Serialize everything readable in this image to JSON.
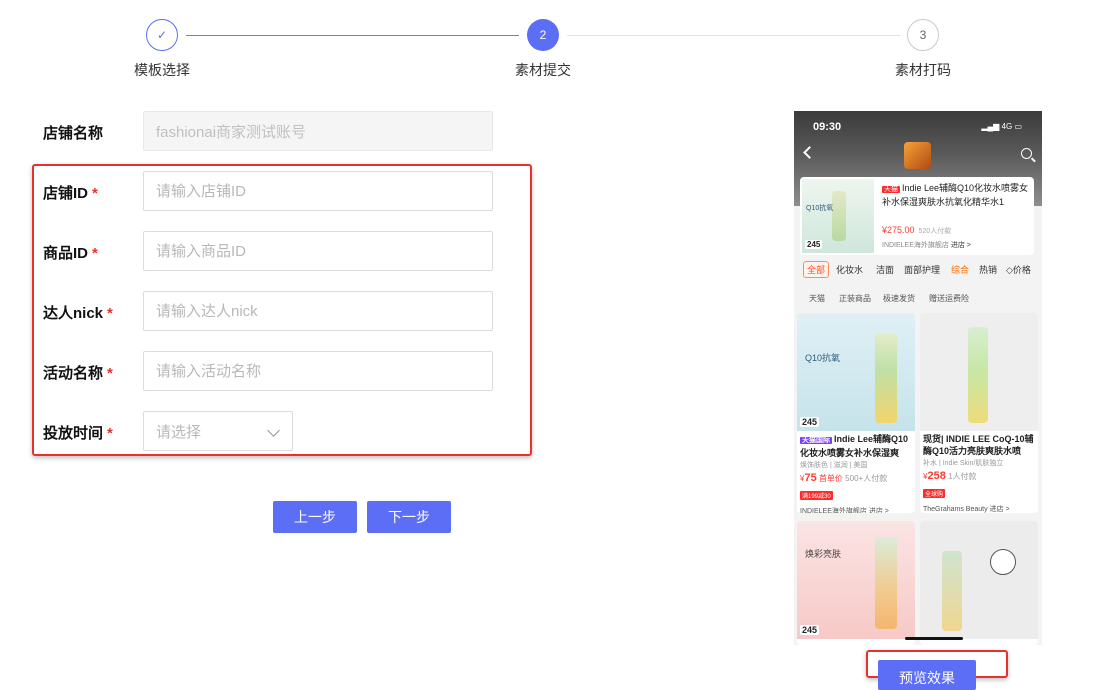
{
  "steps": [
    {
      "index": "✓",
      "label": "模板选择",
      "state": "done"
    },
    {
      "index": "2",
      "label": "素材提交",
      "state": "active"
    },
    {
      "index": "3",
      "label": "素材打码",
      "state": "todo"
    }
  ],
  "form": {
    "shop_name": {
      "label": "店铺名称",
      "value": "fashionai商家测试账号"
    },
    "shop_id": {
      "label": "店铺ID",
      "required": "*",
      "placeholder": "请输入店铺ID"
    },
    "product_id": {
      "label": "商品ID",
      "required": "*",
      "placeholder": "请输入商品ID"
    },
    "influencer_nick": {
      "label": "达人nick",
      "required": "*",
      "placeholder": "请输入达人nick"
    },
    "campaign_name": {
      "label": "活动名称",
      "required": "*",
      "placeholder": "请输入活动名称"
    },
    "launch_time": {
      "label": "投放时间",
      "required": "*",
      "placeholder": "请选择"
    }
  },
  "buttons": {
    "prev": "上一步",
    "next": "下一步",
    "preview": "预览效果"
  },
  "phone": {
    "time": "09:30",
    "status": "4G",
    "top_product": {
      "tag": "天猫",
      "title": "Indie Lee辅酶Q10化妆水喷雾女补水保湿爽肤水抗氧化精华水1",
      "price": "¥275.00",
      "sold": "520人付款",
      "store": "INDIELEE海外旗舰店",
      "store_link": "进店 >",
      "img_label": "Q10抗氧",
      "img_price": "245"
    },
    "tabs": [
      "全部",
      "化妆水",
      "洁面",
      "面部护理",
      "综合",
      "热销",
      "◇价格"
    ],
    "chips": [
      "天猫",
      "正装商品",
      "极速发货",
      "赠送运费险"
    ],
    "cards": [
      {
        "tag": "天猫国际",
        "title": "Indie Lee辅酶Q10化妆水喷雾女补水保湿爽",
        "sub": "焕饰肤色 | 滋润 | 美国",
        "price": "75",
        "price_note": "首单价",
        "sold": "500+人付款",
        "badge": "满199减30",
        "store": "INDIELEE海外旗舰店 进店 >",
        "img_label": "Q10抗氧",
        "img_price": "245"
      },
      {
        "tag": "",
        "title": "现货| INDIE LEE CoQ-10辅酶Q10活力亮肤爽肤水喷",
        "sub": "补水 | Indie Skin/肌肤独立",
        "price": "258",
        "price_note": "",
        "sold": "1人付款",
        "badge": "全球购",
        "store": "TheGrahams Beauty 进店 >",
        "img_label": "",
        "img_price": ""
      },
      {
        "tag": "",
        "title": "",
        "sub": "",
        "price": "",
        "price_note": "",
        "sold": "",
        "badge": "",
        "store": "",
        "img_label": "焕彩亮肤",
        "img_price": "245"
      },
      {
        "tag": "",
        "title": "",
        "sub": "",
        "price": "",
        "price_note": "",
        "sold": "",
        "badge": "",
        "store": "",
        "img_label": "",
        "img_price": ""
      }
    ]
  },
  "colors": {
    "primary": "#5b6ef5",
    "required": "#e5322d",
    "highlight_box": "#e5322d"
  }
}
